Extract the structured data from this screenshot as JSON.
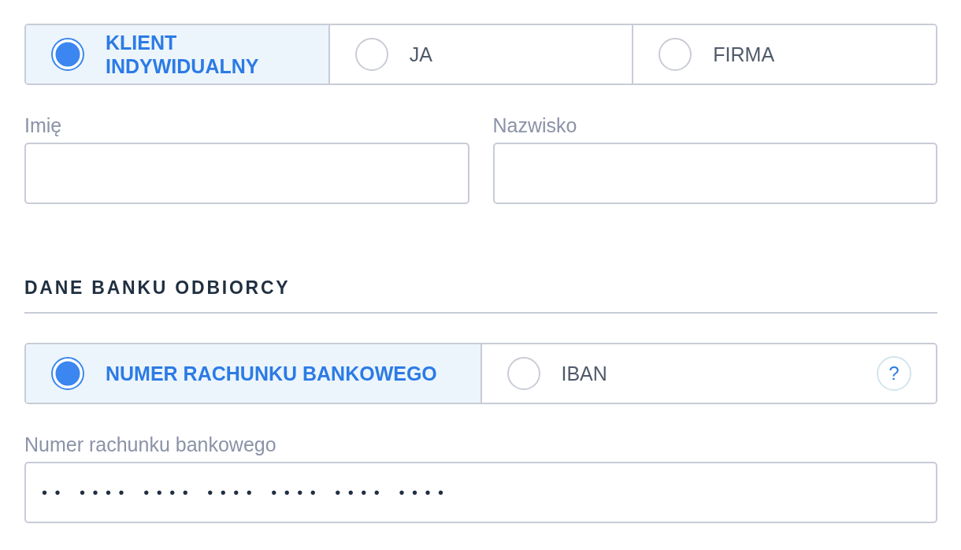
{
  "client_type": {
    "options": [
      {
        "label": "KLIENT INDYWIDUALNY",
        "selected": true
      },
      {
        "label": "JA",
        "selected": false
      },
      {
        "label": "FIRMA",
        "selected": false
      }
    ]
  },
  "name_fields": [
    {
      "label": "Imię"
    },
    {
      "label": "Nazwisko"
    }
  ],
  "bank_section": {
    "heading": "DANE BANKU ODBIORCY",
    "account_type": {
      "options": [
        {
          "label": "NUMER RACHUNKU BANKOWEGO",
          "selected": true
        },
        {
          "label": "IBAN",
          "selected": false,
          "help": "?"
        }
      ]
    },
    "account_field": {
      "label": "Numer rachunku bankowego",
      "value": "•• •••• •••• •••• •••• •••• ••••"
    }
  }
}
